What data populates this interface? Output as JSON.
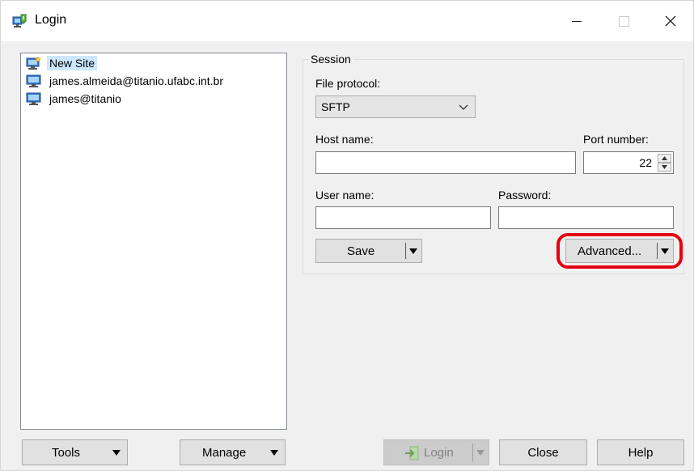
{
  "window": {
    "title": "Login",
    "controls": {
      "minimize": "minimize",
      "maximize": "maximize",
      "close": "close"
    }
  },
  "sites": {
    "items": [
      {
        "label": "New Site",
        "icon": "new-site-icon",
        "selected": true
      },
      {
        "label": "james.almeida@titanio.ufabc.int.br",
        "icon": "computer-icon",
        "selected": false
      },
      {
        "label": "james@titanio",
        "icon": "computer-icon",
        "selected": false
      }
    ]
  },
  "session": {
    "group_label": "Session",
    "file_protocol_label": "File protocol:",
    "file_protocol_value": "SFTP",
    "host_name_label": "Host name:",
    "host_name_value": "",
    "port_number_label": "Port number:",
    "port_number_value": "22",
    "user_name_label": "User name:",
    "user_name_value": "",
    "password_label": "Password:",
    "password_value": "",
    "save_label": "Save",
    "advanced_label": "Advanced..."
  },
  "footer": {
    "tools_label": "Tools",
    "manage_label": "Manage",
    "login_label": "Login",
    "close_label": "Close",
    "help_label": "Help"
  },
  "colors": {
    "selection": "#cce8ff",
    "highlight_ring": "#e60012",
    "button_face": "#e1e1e1",
    "window_bg": "#f0f0f0"
  }
}
